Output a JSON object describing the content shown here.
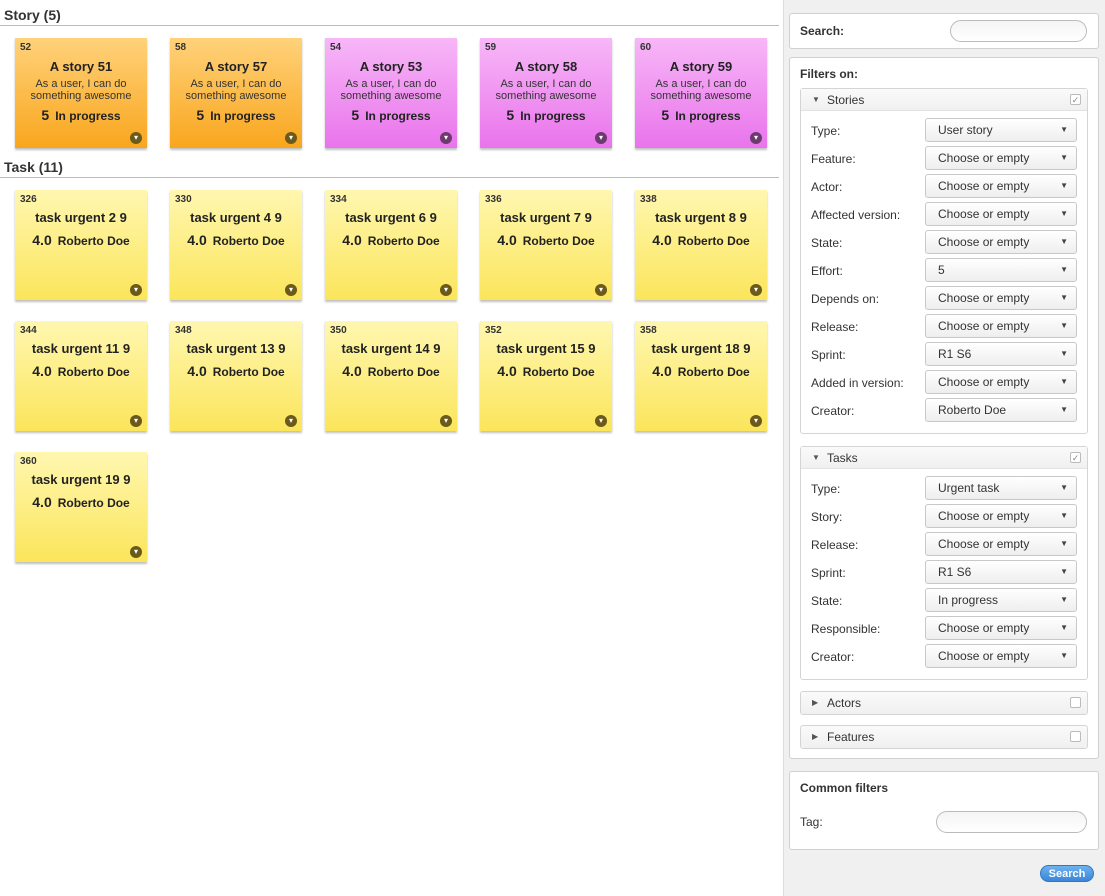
{
  "board": {
    "story_section_title": "Story (5)",
    "task_section_title": "Task (11)",
    "stories": [
      {
        "id": "52",
        "title": "A story 51",
        "desc": "As a user, I can do something awesome",
        "effort": "5",
        "state": "In progress",
        "color": "#f9a61e"
      },
      {
        "id": "58",
        "title": "A story 57",
        "desc": "As a user, I can do something awesome",
        "effort": "5",
        "state": "In progress",
        "color": "#f9a61e"
      },
      {
        "id": "54",
        "title": "A story 53",
        "desc": "As a user, I can do something awesome",
        "effort": "5",
        "state": "In progress",
        "color": "#e974ec"
      },
      {
        "id": "59",
        "title": "A story 58",
        "desc": "As a user, I can do something awesome",
        "effort": "5",
        "state": "In progress",
        "color": "#e974ec"
      },
      {
        "id": "60",
        "title": "A story 59",
        "desc": "As a user, I can do something awesome",
        "effort": "5",
        "state": "In progress",
        "color": "#e974ec"
      }
    ],
    "tasks": [
      {
        "id": "326",
        "title": "task urgent 2 9",
        "estimate": "4.0",
        "person": "Roberto Doe"
      },
      {
        "id": "330",
        "title": "task urgent 4 9",
        "estimate": "4.0",
        "person": "Roberto Doe"
      },
      {
        "id": "334",
        "title": "task urgent 6 9",
        "estimate": "4.0",
        "person": "Roberto Doe"
      },
      {
        "id": "336",
        "title": "task urgent 7 9",
        "estimate": "4.0",
        "person": "Roberto Doe"
      },
      {
        "id": "338",
        "title": "task urgent 8 9",
        "estimate": "4.0",
        "person": "Roberto Doe"
      },
      {
        "id": "344",
        "title": "task urgent 11 9",
        "estimate": "4.0",
        "person": "Roberto Doe"
      },
      {
        "id": "348",
        "title": "task urgent 13 9",
        "estimate": "4.0",
        "person": "Roberto Doe"
      },
      {
        "id": "350",
        "title": "task urgent 14 9",
        "estimate": "4.0",
        "person": "Roberto Doe"
      },
      {
        "id": "352",
        "title": "task urgent 15 9",
        "estimate": "4.0",
        "person": "Roberto Doe"
      },
      {
        "id": "358",
        "title": "task urgent 18 9",
        "estimate": "4.0",
        "person": "Roberto Doe"
      },
      {
        "id": "360",
        "title": "task urgent 19 9",
        "estimate": "4.0",
        "person": "Roberto Doe"
      }
    ],
    "task_color": "#fbe55b"
  },
  "sidebar": {
    "search_label": "Search:",
    "filters_label": "Filters on:",
    "stories_panel": {
      "title": "Stories",
      "checked": true,
      "rows": [
        {
          "label": "Type:",
          "value": "User story"
        },
        {
          "label": "Feature:",
          "value": "Choose or empty"
        },
        {
          "label": "Actor:",
          "value": "Choose or empty"
        },
        {
          "label": "Affected version:",
          "value": "Choose or empty"
        },
        {
          "label": "State:",
          "value": "Choose or empty"
        },
        {
          "label": "Effort:",
          "value": "5"
        },
        {
          "label": "Depends on:",
          "value": "Choose or empty"
        },
        {
          "label": "Release:",
          "value": "Choose or empty"
        },
        {
          "label": "Sprint:",
          "value": "R1 S6"
        },
        {
          "label": "Added in version:",
          "value": "Choose or empty"
        },
        {
          "label": "Creator:",
          "value": "Roberto Doe"
        }
      ]
    },
    "tasks_panel": {
      "title": "Tasks",
      "checked": true,
      "rows": [
        {
          "label": "Type:",
          "value": "Urgent task"
        },
        {
          "label": "Story:",
          "value": "Choose or empty"
        },
        {
          "label": "Release:",
          "value": "Choose or empty"
        },
        {
          "label": "Sprint:",
          "value": "R1 S6"
        },
        {
          "label": "State:",
          "value": "In progress"
        },
        {
          "label": "Responsible:",
          "value": "Choose or empty"
        },
        {
          "label": "Creator:",
          "value": "Choose or empty"
        }
      ]
    },
    "actors_panel": {
      "title": "Actors",
      "checked": false
    },
    "features_panel": {
      "title": "Features",
      "checked": false
    },
    "common_filters_label": "Common filters",
    "tag_label": "Tag:",
    "search_button": "Search",
    "accent_color": "#3a86d8"
  },
  "icons": {
    "expanded": "triangle-down-icon",
    "collapsed": "triangle-right-icon",
    "dropdown": "caret-down-icon",
    "card_menu": "chevron-circle-down-icon"
  }
}
